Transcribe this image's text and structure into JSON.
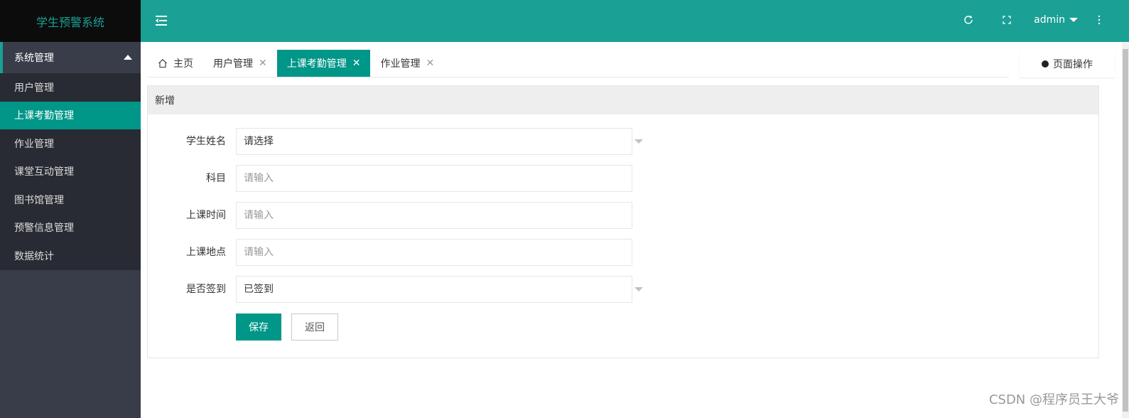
{
  "app": {
    "title": "学生预警系统"
  },
  "sidebar": {
    "group_label": "系统管理",
    "items": [
      {
        "label": "用户管理",
        "active": false
      },
      {
        "label": "上课考勤管理",
        "active": true
      },
      {
        "label": "作业管理",
        "active": false
      },
      {
        "label": "课堂互动管理",
        "active": false
      },
      {
        "label": "图书馆管理",
        "active": false
      },
      {
        "label": "预警信息管理",
        "active": false
      },
      {
        "label": "数据统计",
        "active": false
      }
    ]
  },
  "header": {
    "user": "admin"
  },
  "tabs": [
    {
      "label": "主页",
      "closable": false,
      "active": false,
      "icon": "home-icon"
    },
    {
      "label": "用户管理",
      "closable": true,
      "active": false
    },
    {
      "label": "上课考勤管理",
      "closable": true,
      "active": true
    },
    {
      "label": "作业管理",
      "closable": true,
      "active": false
    }
  ],
  "page_ops": {
    "label": "页面操作"
  },
  "panel": {
    "title": "新增",
    "fields": {
      "student": {
        "label": "学生姓名",
        "value": "请选择"
      },
      "subject": {
        "label": "科目",
        "placeholder": "请输入"
      },
      "time": {
        "label": "上课时间",
        "placeholder": "请输入"
      },
      "place": {
        "label": "上课地点",
        "placeholder": "请输入"
      },
      "signed": {
        "label": "是否签到",
        "value": "已签到"
      }
    },
    "save_label": "保存",
    "back_label": "返回"
  },
  "watermark": "CSDN @程序员王大爷",
  "colors": {
    "accent": "#009688",
    "header": "#1aa094",
    "sidebar": "#393d49"
  }
}
